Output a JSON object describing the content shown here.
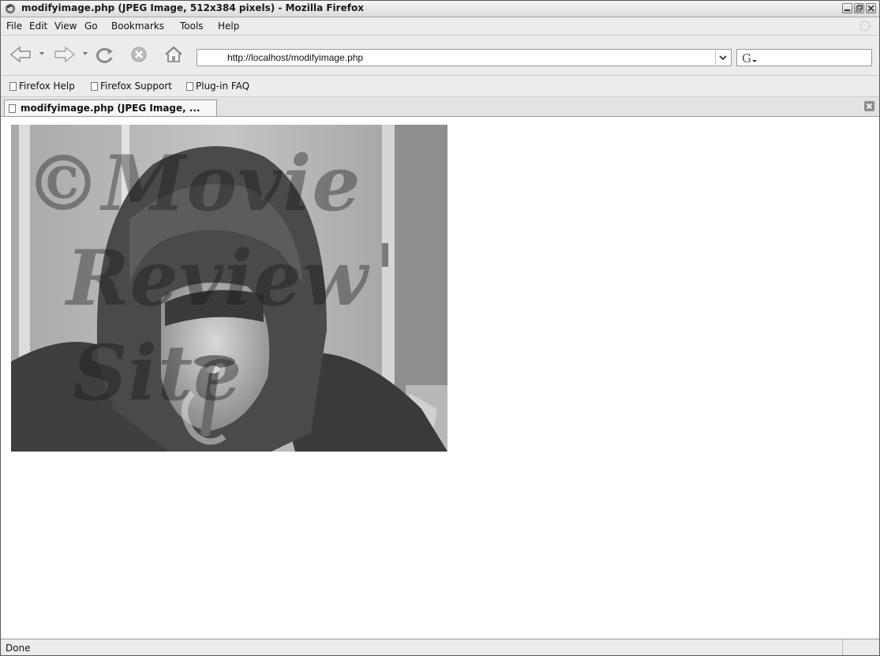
{
  "window": {
    "title": "modifyimage.php (JPEG Image, 512x384 pixels) - Mozilla Firefox"
  },
  "menu": [
    "File",
    "Edit",
    "View",
    "Go",
    "Bookmarks",
    "Tools",
    "Help"
  ],
  "navigation": {
    "url": "http://localhost/modifyimage.php",
    "icons": [
      "back-arrow-icon",
      "forward-arrow-icon",
      "reload-icon",
      "stop-icon",
      "home-icon"
    ]
  },
  "search": {
    "engine_icon": "google-icon",
    "value": ""
  },
  "bookmarks": [
    "Firefox Help",
    "Firefox Support",
    "Plug-in FAQ"
  ],
  "tab": {
    "label": "modifyimage.php (JPEG Image, ..."
  },
  "image": {
    "watermark_lines": [
      "©Movie",
      "Review",
      "Site"
    ]
  },
  "status": {
    "text": "Done"
  }
}
